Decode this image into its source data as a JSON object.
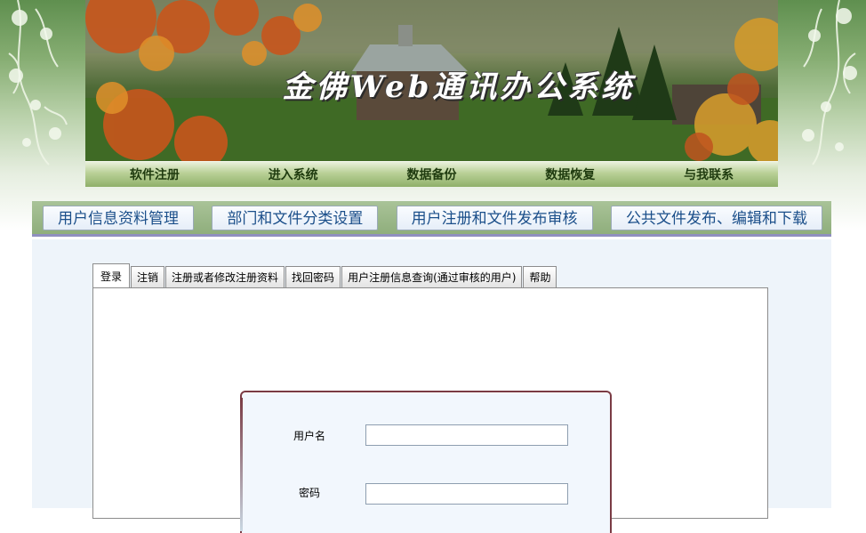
{
  "banner": {
    "title": "金佛Web通讯办公系统"
  },
  "top_nav": {
    "items": [
      "软件注册",
      "进入系统",
      "数据备份",
      "数据恢复",
      "与我联系"
    ]
  },
  "modules": {
    "buttons": [
      "用户信息资料管理",
      "部门和文件分类设置",
      "用户注册和文件发布审核",
      "公共文件发布、编辑和下载"
    ]
  },
  "tabs": {
    "items": [
      "登录",
      "注销",
      "注册或者修改注册资料",
      "找回密码",
      "用户注册信息查询(通过审核的用户)",
      "帮助"
    ],
    "active": "登录"
  },
  "login": {
    "username_label": "用户名",
    "username_value": "",
    "password_label": "密码",
    "password_value": ""
  },
  "colors": {
    "module_text": "#1b4f8a",
    "nav_text": "#1f3b0f",
    "login_border": "#7a3b44"
  }
}
